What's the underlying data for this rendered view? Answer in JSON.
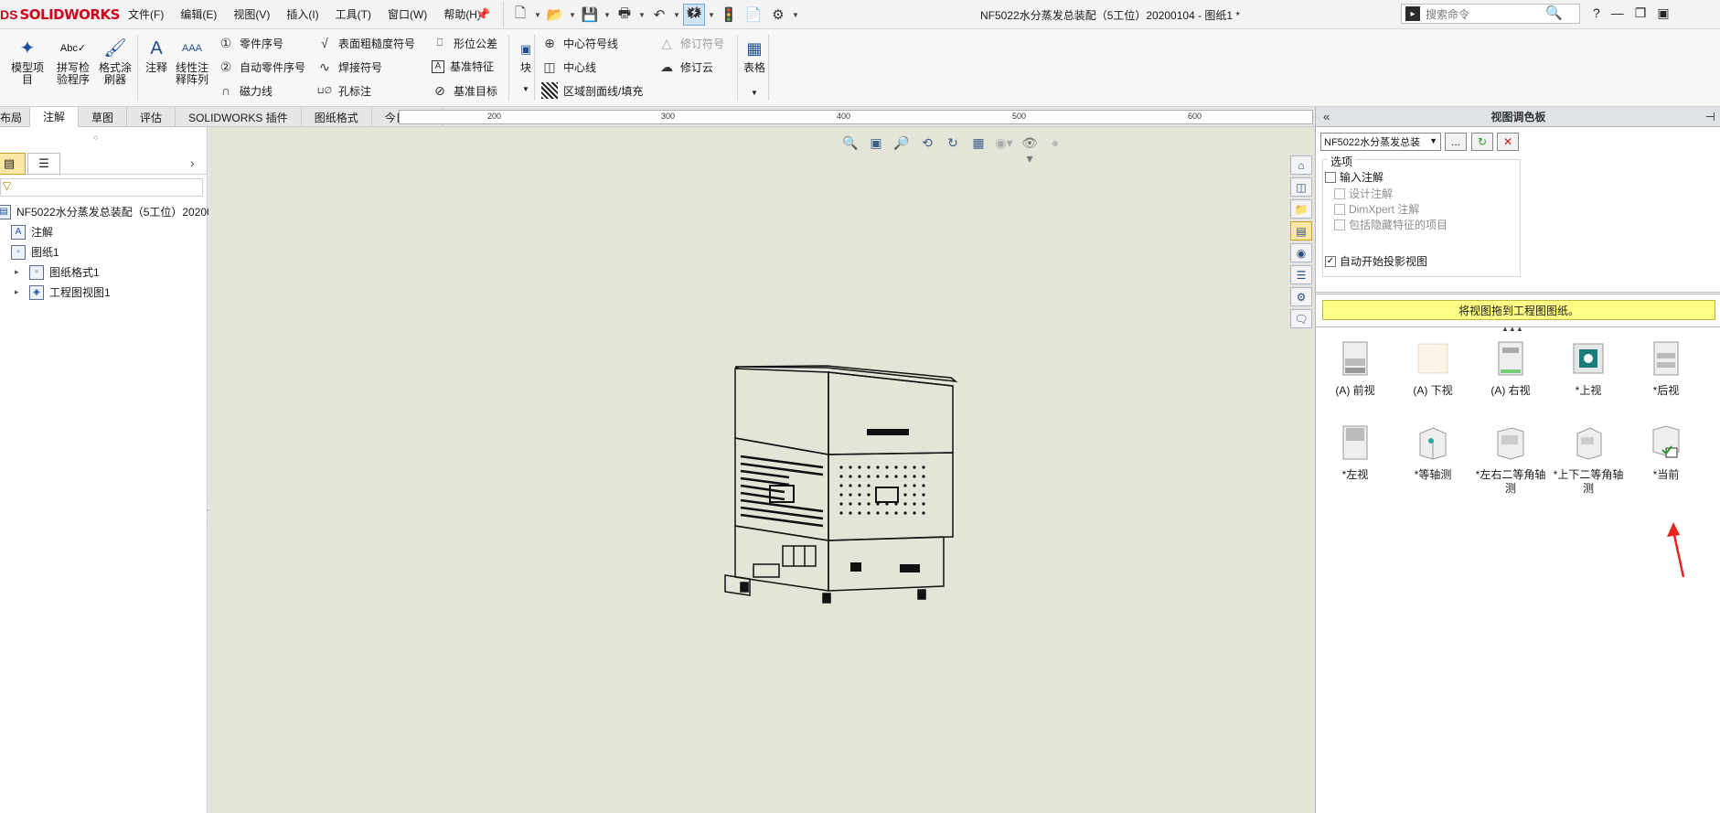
{
  "app": {
    "logo_mark": "DS",
    "logo_text": "SOLIDWORKS",
    "doc_title": "NF5022水分蒸发总装配（5工位）20200104 - 图纸1 *"
  },
  "menu": [
    "文件(F)",
    "编辑(E)",
    "视图(V)",
    "插入(I)",
    "工具(T)",
    "窗口(W)",
    "帮助(H)"
  ],
  "search": {
    "placeholder": "搜索命令"
  },
  "ribbon": {
    "model_items": "模型项\n目",
    "spell_check": "拼写检\n验程序",
    "format_painter": "格式涂\n刷器",
    "note": "注释",
    "linear_note_pattern": "线性注\n释阵列",
    "balloon": "零件序号",
    "auto_balloon": "自动零件序号",
    "magnetic_line": "磁力线",
    "surface_finish": "表面粗糙度符号",
    "weld_symbol": "焊接符号",
    "hole_callout": "孔标注",
    "geometric_tolerance": "形位公差",
    "datum_feature": "基准特征",
    "datum_target": "基准目标",
    "block": "块",
    "center_mark": "中心符号线",
    "centerline": "中心线",
    "area_hatch": "区域剖面线/填充",
    "revision_symbol": "修订符号",
    "revision_cloud": "修订云",
    "table": "表格"
  },
  "tabs": [
    "布局",
    "注解",
    "草图",
    "评估",
    "SOLIDWORKS 插件",
    "图纸格式",
    "今日制造"
  ],
  "active_tab": "注解",
  "ruler_labels": [
    "200",
    "300",
    "400",
    "500",
    "600"
  ],
  "tree": {
    "root": "NF5022水分蒸发总装配（5工位）20200",
    "items": [
      "注解",
      "图纸1",
      "图纸格式1",
      "工程图视图1"
    ]
  },
  "palette": {
    "title": "视图调色板",
    "select_value": "NF5022水分蒸发总装",
    "more_button": "...",
    "options_title": "选项",
    "opt_import_annotations": "输入注解",
    "opt_design_annotations": "设计注解",
    "opt_dimxpert": "DimXpert 注解",
    "opt_hidden_features": "包括隐藏特征的项目",
    "opt_auto_projected": "自动开始投影视图",
    "drag_hint": "将视图拖到工程图图纸。",
    "views": [
      "(A) 前视",
      "(A) 下视",
      "(A) 右视",
      "*上视",
      "*后视",
      "*左视",
      "*等轴测",
      "*左右二等角轴测",
      "*上下二等角轴测",
      "*当前"
    ]
  },
  "colors": {
    "canvas": "#e4e4d8",
    "brand_red": "#d0021b",
    "hint_yellow": "#ffff88",
    "annotation_arrow": "#e8231f"
  }
}
